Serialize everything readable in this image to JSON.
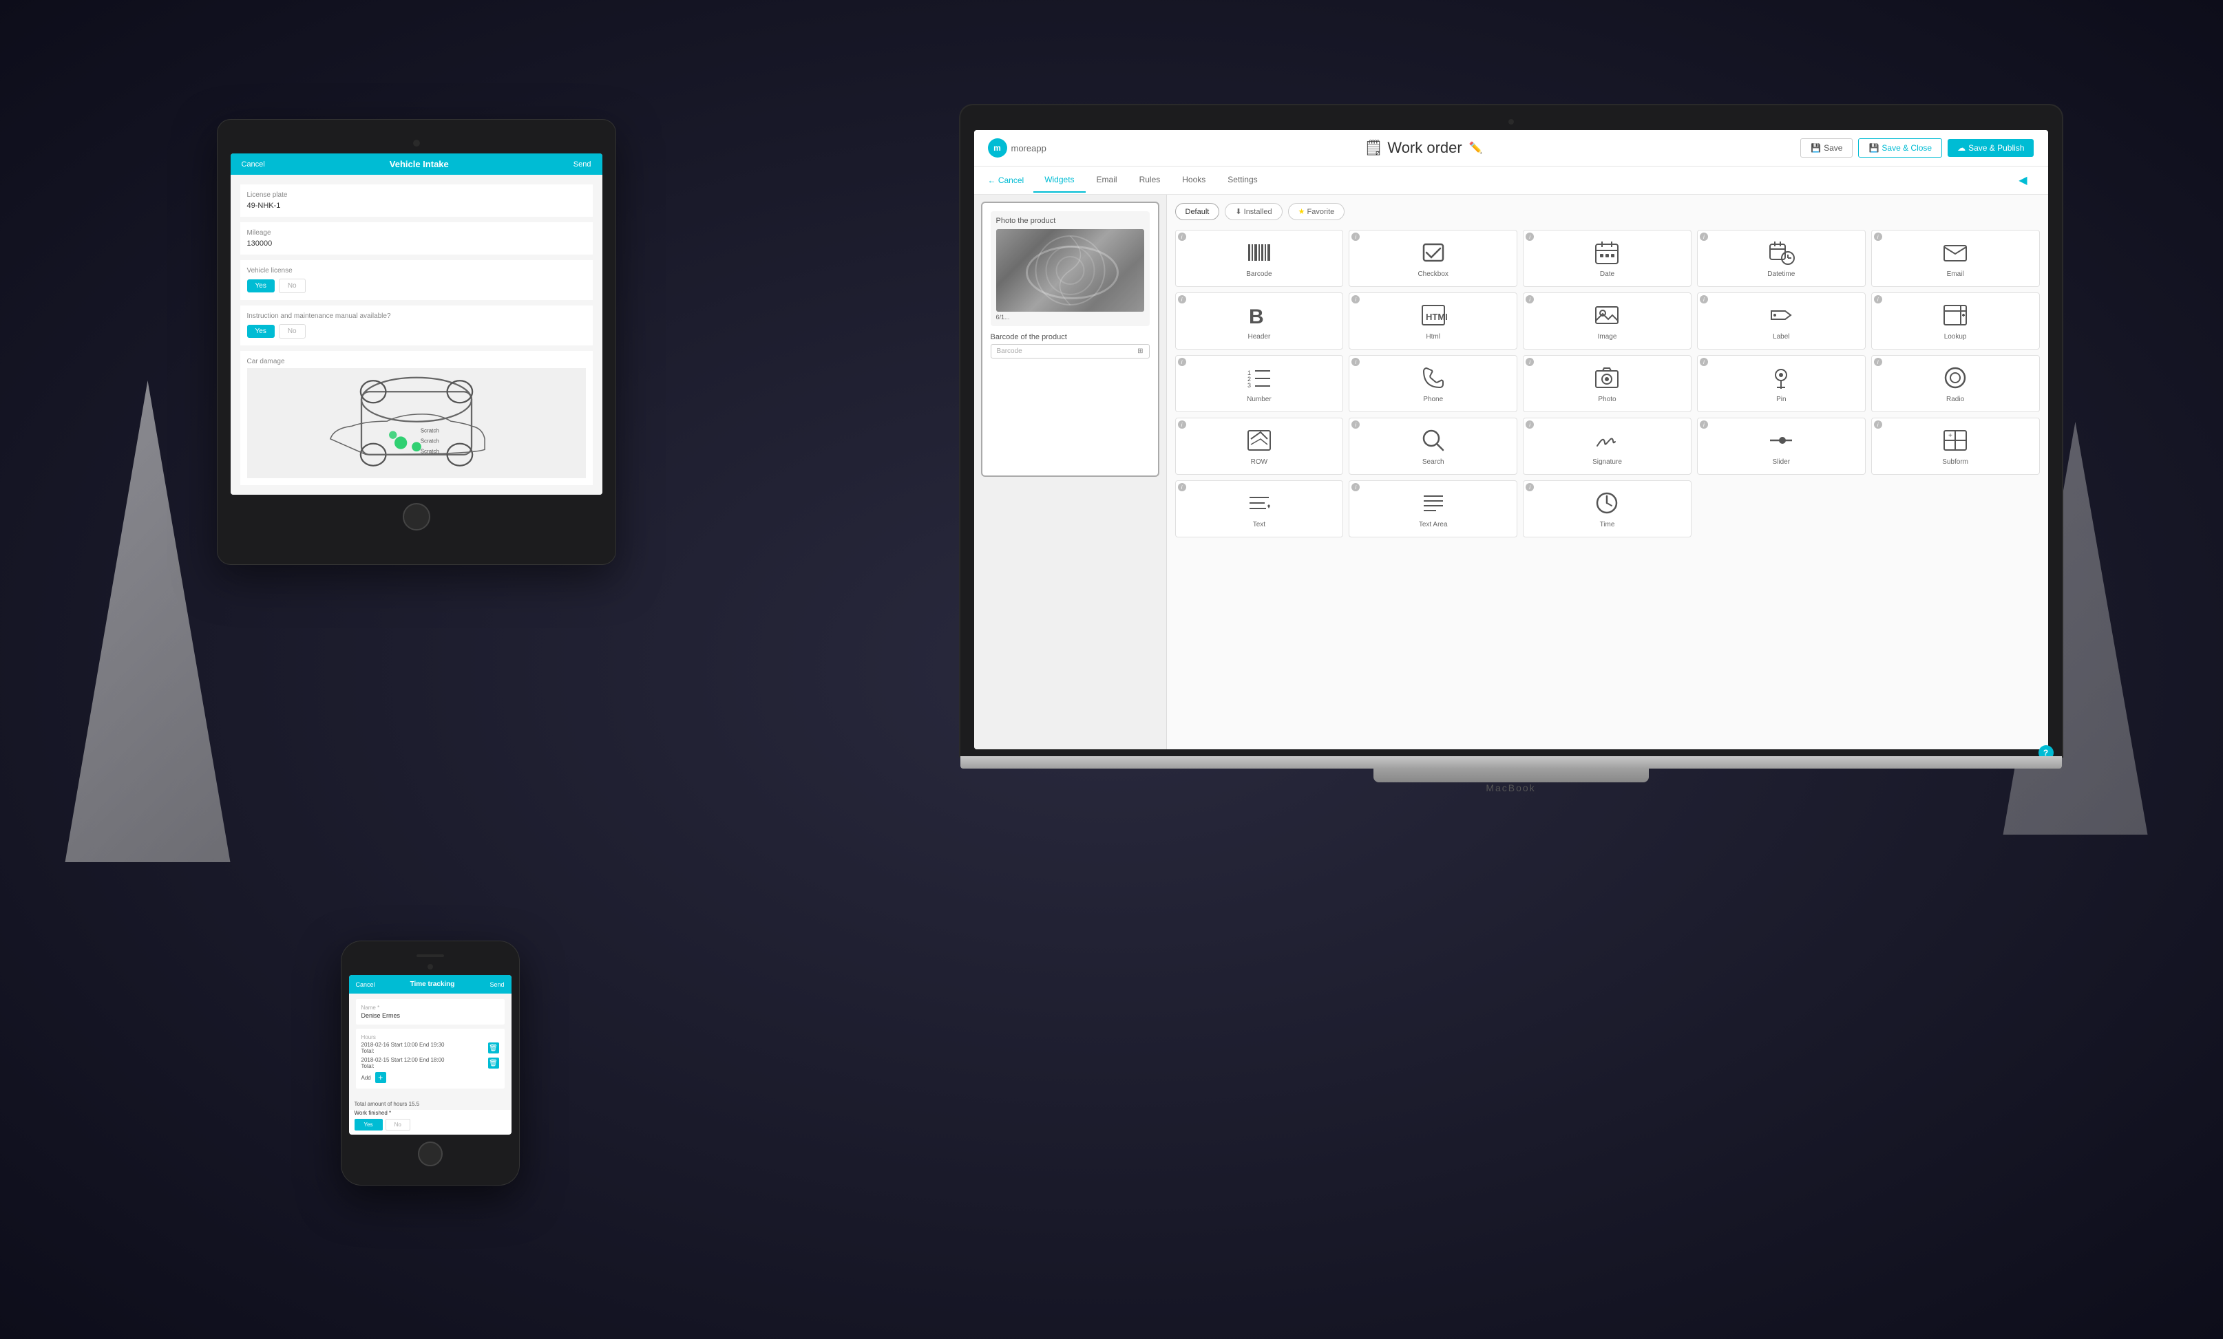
{
  "laptop": {
    "brand": "MacBook",
    "app": {
      "logo": "moreapp",
      "title": "Work order",
      "nav": {
        "cancel": "← Cancel",
        "tabs": [
          "Widgets",
          "Email",
          "Rules",
          "Hooks",
          "Settings"
        ],
        "active_tab": "Widgets"
      },
      "actions": {
        "save": "Save",
        "save_close": "Save & Close",
        "save_publish": "Save & Publish"
      },
      "filters": [
        "Default",
        "Installed",
        "Favorite"
      ],
      "form_preview": {
        "photo_title": "Photo the product",
        "barcode_title": "Barcode of the product",
        "barcode_placeholder": "Barcode"
      },
      "widgets": [
        {
          "name": "Barcode",
          "icon": "barcode"
        },
        {
          "name": "Checkbox",
          "icon": "checkbox"
        },
        {
          "name": "Date",
          "icon": "date"
        },
        {
          "name": "Datetime",
          "icon": "datetime"
        },
        {
          "name": "Email",
          "icon": "email"
        },
        {
          "name": "Header",
          "icon": "header"
        },
        {
          "name": "Html",
          "icon": "html"
        },
        {
          "name": "Image",
          "icon": "image"
        },
        {
          "name": "Label",
          "icon": "label"
        },
        {
          "name": "Lookup",
          "icon": "lookup"
        },
        {
          "name": "Number",
          "icon": "number"
        },
        {
          "name": "Phone",
          "icon": "phone"
        },
        {
          "name": "Photo",
          "icon": "photo"
        },
        {
          "name": "Pin",
          "icon": "pin"
        },
        {
          "name": "Radio",
          "icon": "radio"
        },
        {
          "name": "ROW",
          "icon": "row"
        },
        {
          "name": "Search",
          "icon": "search"
        },
        {
          "name": "Signature",
          "icon": "signature"
        },
        {
          "name": "Slider",
          "icon": "slider"
        },
        {
          "name": "Subform",
          "icon": "subform"
        },
        {
          "name": "Text",
          "icon": "text"
        },
        {
          "name": "Text Area",
          "icon": "textarea"
        },
        {
          "name": "Time",
          "icon": "time"
        }
      ]
    }
  },
  "tablet": {
    "header": {
      "cancel": "Cancel",
      "title": "Vehicle Intake",
      "send": "Send"
    },
    "fields": [
      {
        "label": "License plate",
        "value": "49-NHK-1"
      },
      {
        "label": "Mileage",
        "value": "130000"
      },
      {
        "label": "Vehicle license",
        "type": "toggle"
      },
      {
        "label": "Instruction and maintenance manual available?",
        "type": "toggle"
      }
    ],
    "damage_label": "Car damage"
  },
  "phone": {
    "header": {
      "cancel": "Cancel",
      "title": "Time tracking",
      "send": "Send"
    },
    "name_label": "Name *",
    "name_value": "Denise Ermes",
    "hours_label": "Hours",
    "hour_entries": [
      {
        "text": "2018-02-16 Start 10:00 End 19:30",
        "total": "Total:"
      },
      {
        "text": "2018-02-15 Start 12:00 End 18:00",
        "total": "Total:"
      }
    ],
    "add_label": "Add",
    "total_hours": "Total amount of hours",
    "total_value": "15.5",
    "work_finished": "Work finished *",
    "yes": "Yes",
    "no": "No"
  }
}
